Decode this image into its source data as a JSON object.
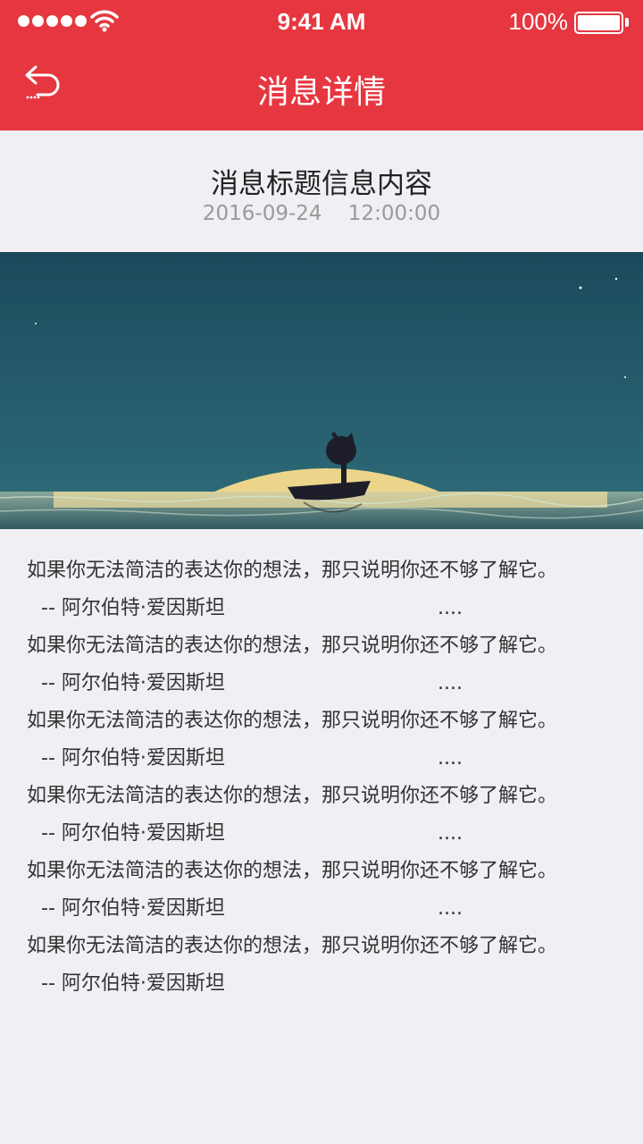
{
  "status_bar": {
    "time": "9:41 AM",
    "battery": "100%"
  },
  "nav": {
    "title": "消息详情",
    "back_icon": "back-arrow-icon"
  },
  "article": {
    "title": "消息标题信息内容",
    "datetime": "2016-09-24    12:00:00",
    "hero_image": "moon-boat-illustration",
    "lines": [
      {
        "text": "如果你无法简洁的表达你的想法，那只说明你还不够了解它。",
        "author": "-- 阿尔伯特·爱因斯坦",
        "ellipsis": "...."
      },
      {
        "text": "如果你无法简洁的表达你的想法，那只说明你还不够了解它。",
        "author": "-- 阿尔伯特·爱因斯坦",
        "ellipsis": "...."
      },
      {
        "text": "如果你无法简洁的表达你的想法，那只说明你还不够了解它。",
        "author": "-- 阿尔伯特·爱因斯坦",
        "ellipsis": "...."
      },
      {
        "text": "如果你无法简洁的表达你的想法，那只说明你还不够了解它。",
        "author": "-- 阿尔伯特·爱因斯坦",
        "ellipsis": "...."
      },
      {
        "text": "如果你无法简洁的表达你的想法，那只说明你还不够了解它。",
        "author": "-- 阿尔伯特·爱因斯坦",
        "ellipsis": "...."
      },
      {
        "text": "如果你无法简洁的表达你的想法，那只说明你还不够了解它。",
        "author": "-- 阿尔伯特·爱因斯坦",
        "ellipsis": ""
      }
    ]
  },
  "colors": {
    "header": "#e63740",
    "background": "#efeff4",
    "title_text": "#222222",
    "meta_text": "#9a9a9a"
  }
}
